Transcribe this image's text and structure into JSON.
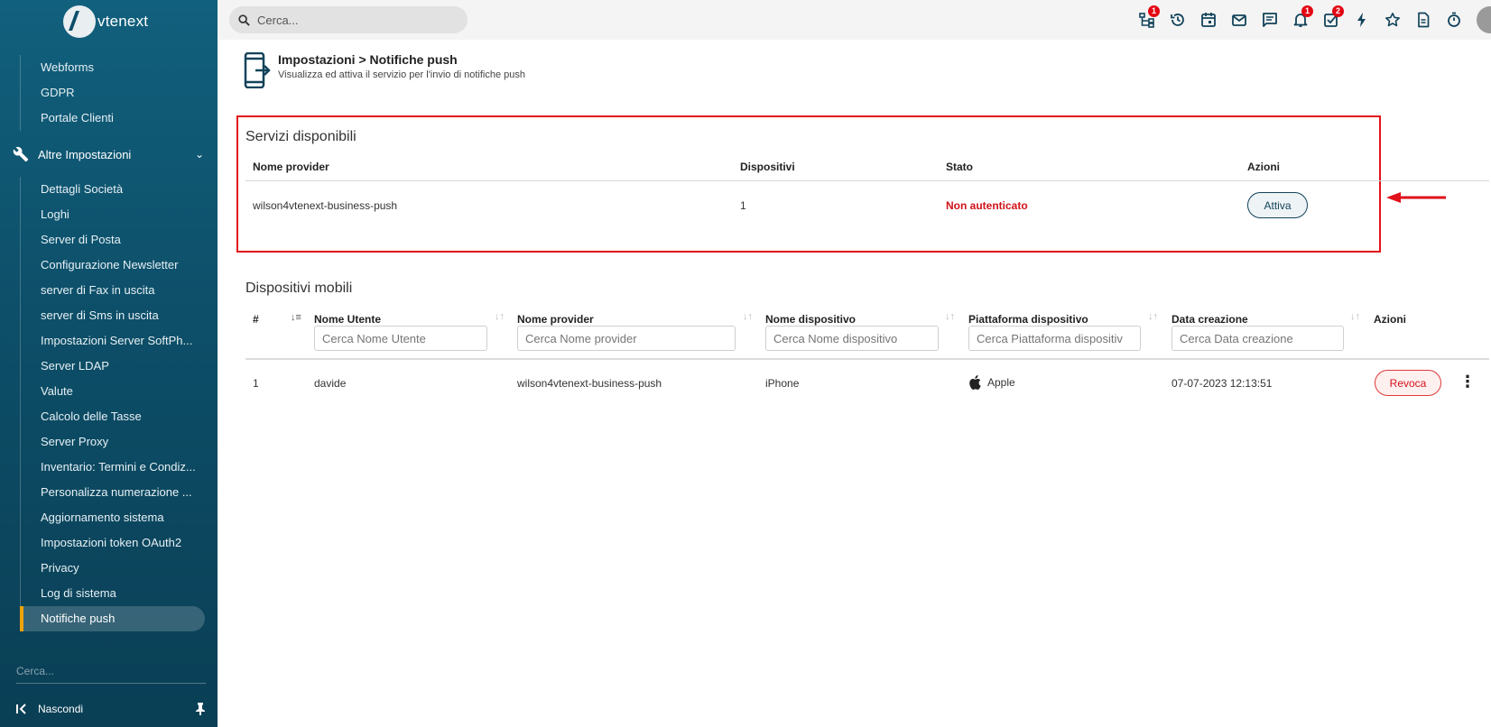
{
  "brand": {
    "name": "vtenext"
  },
  "sidebar": {
    "items_top": [
      {
        "label": "Webforms"
      },
      {
        "label": "GDPR"
      },
      {
        "label": "Portale Clienti"
      }
    ],
    "section": {
      "label": "Altre Impostazioni"
    },
    "items": [
      {
        "label": "Dettagli Società"
      },
      {
        "label": "Loghi"
      },
      {
        "label": "Server di Posta"
      },
      {
        "label": "Configurazione Newsletter"
      },
      {
        "label": "server di Fax in uscita"
      },
      {
        "label": "server di Sms in uscita"
      },
      {
        "label": "Impostazioni Server SoftPh..."
      },
      {
        "label": "Server LDAP"
      },
      {
        "label": "Valute"
      },
      {
        "label": "Calcolo delle Tasse"
      },
      {
        "label": "Server Proxy"
      },
      {
        "label": "Inventario: Termini e Condiz..."
      },
      {
        "label": "Personalizza numerazione ..."
      },
      {
        "label": "Aggiornamento sistema"
      },
      {
        "label": "Impostazioni token OAuth2"
      },
      {
        "label": "Privacy"
      },
      {
        "label": "Log di sistema"
      },
      {
        "label": "Notifiche push"
      }
    ],
    "search_placeholder": "Cerca...",
    "footer_label": "Nascondi"
  },
  "topbar": {
    "search_placeholder": "Cerca...",
    "badges": {
      "tree": "1",
      "bell": "1",
      "tasks": "2"
    }
  },
  "page": {
    "title": "Impostazioni > Notifiche push",
    "subtitle": "Visualizza ed attiva il servizio per l'invio di notifiche push"
  },
  "services": {
    "title": "Servizi disponibili",
    "headers": {
      "provider": "Nome provider",
      "devices": "Dispositivi",
      "status": "Stato",
      "actions": "Azioni"
    },
    "row": {
      "provider": "wilson4vtenext-business-push",
      "devices": "1",
      "status": "Non autenticato",
      "action": "Attiva"
    }
  },
  "devices": {
    "title": "Dispositivi mobili",
    "headers": {
      "num": "#",
      "user": "Nome Utente",
      "provider": "Nome provider",
      "device": "Nome dispositivo",
      "platform": "Piattaforma dispositivo",
      "created": "Data creazione",
      "actions": "Azioni"
    },
    "filters": {
      "user": "Cerca Nome Utente",
      "provider": "Cerca Nome provider",
      "device": "Cerca Nome dispositivo",
      "platform": "Cerca Piattaforma dispositiv",
      "created": "Cerca Data creazione"
    },
    "row": {
      "num": "1",
      "user": "davide",
      "provider": "wilson4vtenext-business-push",
      "device": "iPhone",
      "platform": "Apple",
      "created": "07-07-2023 12:13:51",
      "action": "Revoca"
    }
  },
  "colors": {
    "sidebar": "#0d4e68",
    "highlight": "#e0121b",
    "accent": "#f0a30a",
    "danger": "#d2121a"
  }
}
